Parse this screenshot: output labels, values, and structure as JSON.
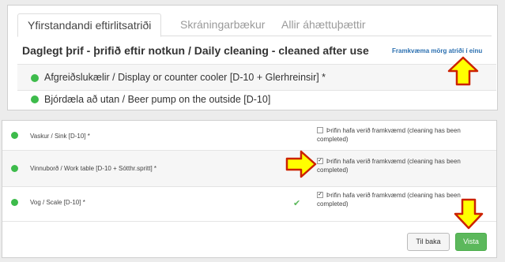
{
  "tabs": [
    {
      "label": "Yfirstandandi eftirlitsatriði",
      "active": true
    },
    {
      "label": "Skráningarbækur",
      "active": false
    },
    {
      "label": "Allir áhættuþættir",
      "active": false
    }
  ],
  "section": {
    "title": "Daglegt þrif - þrifið eftir notkun / Daily cleaning - cleaned after use",
    "mark_all": "Framkvæma mörg atriði í einu"
  },
  "task_list": [
    {
      "label": "Afgreiðslukælir / Display or counter cooler [D-10 + Glerhreinsir] *"
    },
    {
      "label": "Bjórdæla að utan / Beer pump on the outside [D-10]"
    }
  ],
  "checklist": [
    {
      "name": "Vaskur / Sink [D-10] *",
      "checked": false,
      "done": false,
      "checkbox_label": "Þrifin hafa verið framkvæmd (cleaning has been completed)"
    },
    {
      "name": "Vinnuborð / Work table [D-10 + Sótthr.spritt] *",
      "checked": true,
      "done": false,
      "checkbox_label": "Þrifin hafa verið framkvæmd (cleaning has been completed)"
    },
    {
      "name": "Vog / Scale [D-10] *",
      "checked": true,
      "done": true,
      "checkbox_label": "Þrifin hafa verið framkvæmd (cleaning has been completed)"
    }
  ],
  "buttons": {
    "back": "Til baka",
    "save": "Vista"
  },
  "colors": {
    "status_dot": "#3dbb4b",
    "save_button": "#5cb85c",
    "link": "#2a6fb0",
    "arrow_fill": "#ffff00",
    "arrow_stroke": "#cc2200"
  }
}
